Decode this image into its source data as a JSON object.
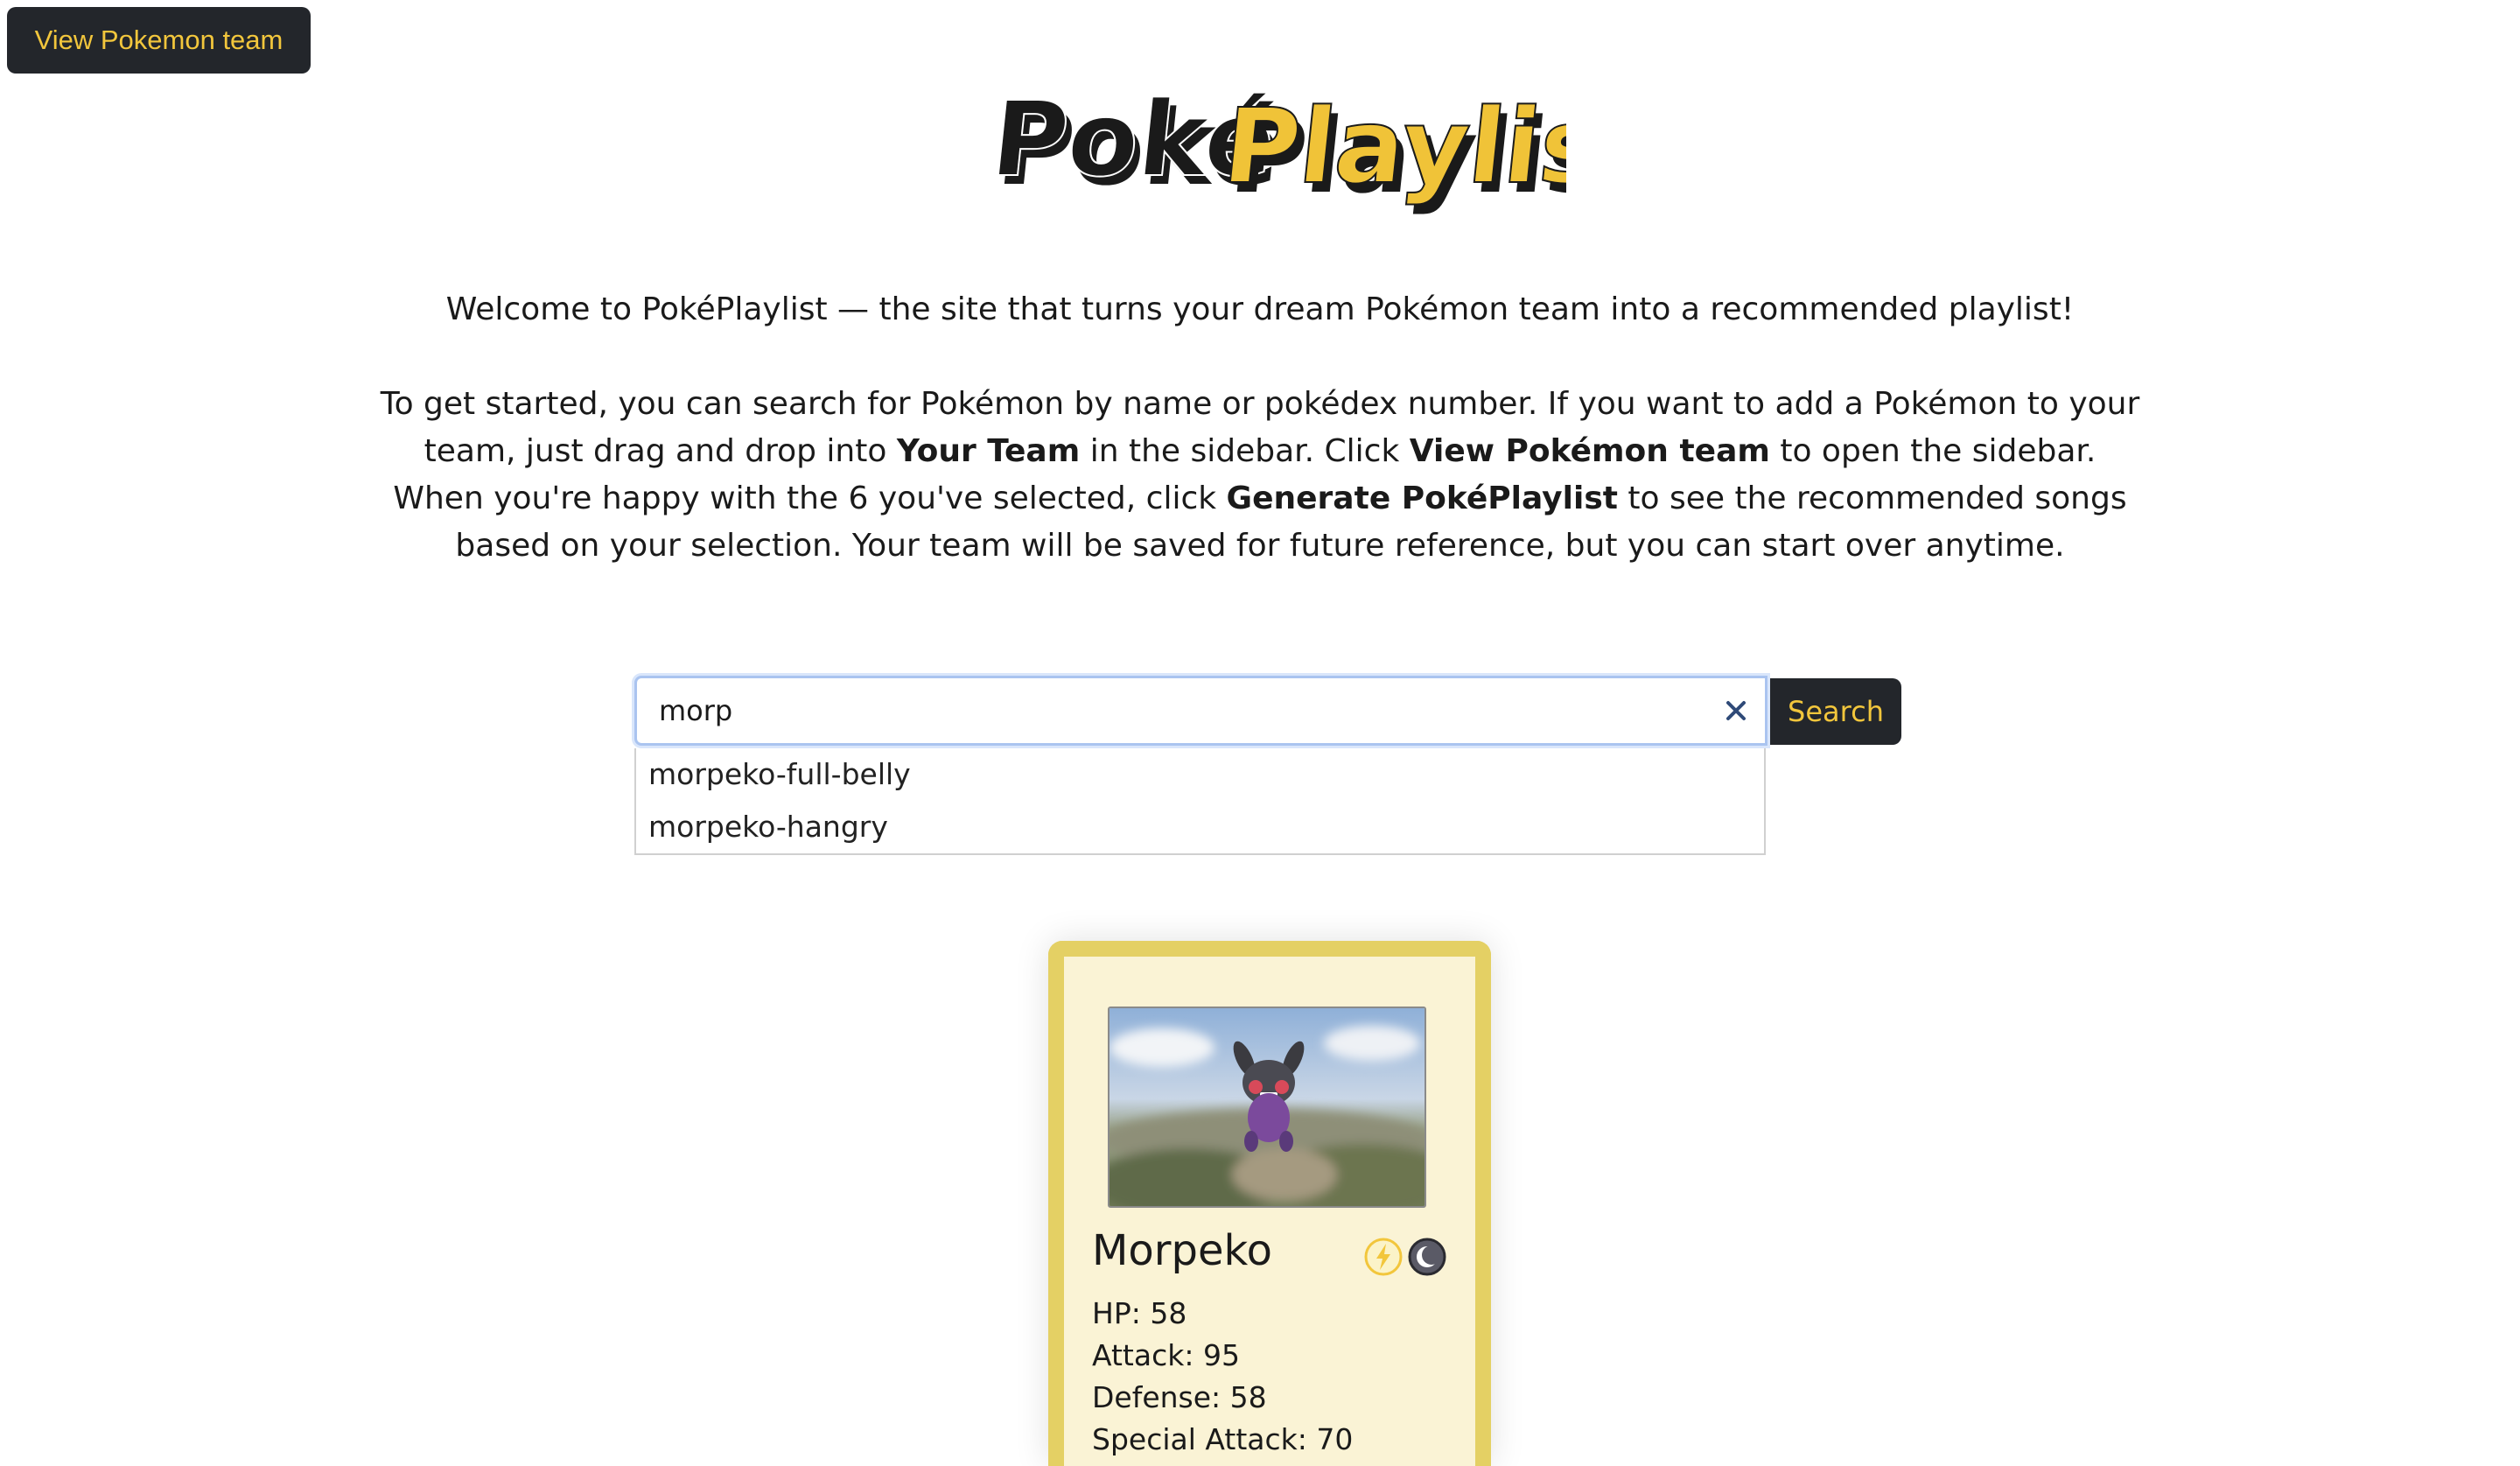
{
  "header": {
    "team_button_label": "View Pokemon team",
    "logo_text_part1": "Poké",
    "logo_text_part2": "Playlist"
  },
  "intro": {
    "welcome": "Welcome to PokéPlaylist — the site that turns your dream Pokémon team into a recommended playlist!",
    "p1": "To get started, you can search for Pokémon by name or pokédex number. If you want to add a Pokémon to your team, just drag and drop into ",
    "b1": "Your Team",
    "p2": " in the sidebar. Click ",
    "b2": "View Pokémon team",
    "p3": " to open the sidebar. When you're happy with the 6 you've selected, click ",
    "b3": "Generate PokéPlaylist",
    "p4": " to see the recommended songs based on your selection. Your team will be saved for future reference, but you can start over anytime."
  },
  "search": {
    "value": "morp",
    "button_label": "Search",
    "suggestions": [
      "morpeko-full-belly",
      "morpeko-hangry"
    ]
  },
  "card": {
    "name": "Morpeko",
    "types": [
      "electric-type-icon",
      "dark-type-icon"
    ],
    "stats": [
      "HP: 58",
      "Attack: 95",
      "Defense: 58",
      "Special Attack: 70"
    ]
  },
  "colors": {
    "button_bg": "#23262b",
    "accent_yellow": "#f2c63c",
    "card_border": "#e4d064",
    "card_bg": "#faf3d5"
  }
}
